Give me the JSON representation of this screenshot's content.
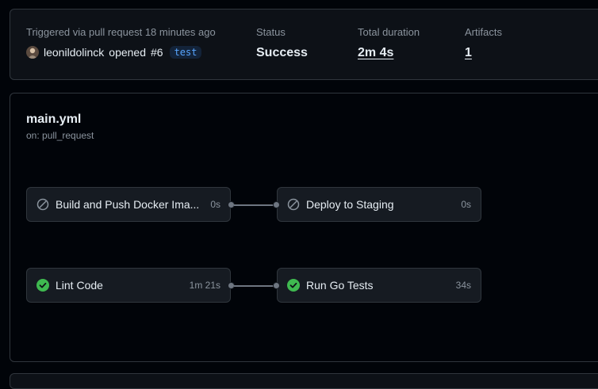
{
  "summary": {
    "trigger_text": "Triggered via pull request 18 minutes ago",
    "actor": "leonildolinck",
    "action": "opened",
    "pr": "#6",
    "branch": "test",
    "status_label": "Status",
    "status_value": "Success",
    "duration_label": "Total duration",
    "duration_value": "2m 4s",
    "artifacts_label": "Artifacts",
    "artifacts_value": "1"
  },
  "workflow": {
    "file": "main.yml",
    "trigger": "on: pull_request",
    "jobs": [
      {
        "name": "Build and Push Docker Ima...",
        "duration": "0s",
        "status": "skipped",
        "icon": "skipped-icon"
      },
      {
        "name": "Deploy to Staging",
        "duration": "0s",
        "status": "skipped",
        "icon": "skipped-icon"
      },
      {
        "name": "Lint Code",
        "duration": "1m 21s",
        "status": "success",
        "icon": "check-circle-icon"
      },
      {
        "name": "Run Go Tests",
        "duration": "34s",
        "status": "success",
        "icon": "check-circle-icon"
      }
    ]
  },
  "colors": {
    "success": "#3fb950",
    "skipped": "#8b949e",
    "branch": "#58a6ff"
  }
}
